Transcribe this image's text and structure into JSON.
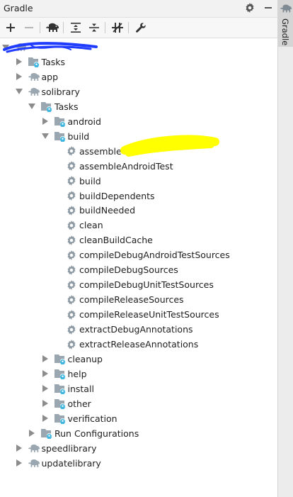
{
  "panel": {
    "title": "Gradle",
    "side_tab_label": "Gradle"
  },
  "header": {
    "settings_icon": "gear-icon",
    "minimize_icon": "minimize-icon"
  },
  "toolbar": {
    "buttons": [
      {
        "name": "add-button",
        "icon": "plus-icon",
        "enabled": true
      },
      {
        "name": "remove-button",
        "icon": "minus-icon",
        "enabled": false
      },
      {
        "name": "execute-gradle-task-button",
        "icon": "elephant-icon",
        "enabled": true
      },
      {
        "name": "expand-all-button",
        "icon": "expand-all-icon",
        "enabled": true
      },
      {
        "name": "collapse-all-button",
        "icon": "collapse-all-icon",
        "enabled": true
      },
      {
        "name": "toggle-offline-mode-button",
        "icon": "offline-icon",
        "enabled": true
      },
      {
        "name": "build-settings-button",
        "icon": "wrench-icon",
        "enabled": true
      }
    ]
  },
  "tree": [
    {
      "depth": 0,
      "expanded": true,
      "icon": "gradle-elephant",
      "label": ""
    },
    {
      "depth": 1,
      "expanded": false,
      "icon": "task-folder",
      "label": "Tasks"
    },
    {
      "depth": 1,
      "expanded": false,
      "icon": "gradle-elephant",
      "label": "app"
    },
    {
      "depth": 1,
      "expanded": true,
      "icon": "gradle-elephant",
      "label": "solibrary"
    },
    {
      "depth": 2,
      "expanded": true,
      "icon": "task-folder",
      "label": "Tasks"
    },
    {
      "depth": 3,
      "expanded": false,
      "icon": "task-folder",
      "label": "android"
    },
    {
      "depth": 3,
      "expanded": true,
      "icon": "task-folder",
      "label": "build"
    },
    {
      "depth": 4,
      "leaf": true,
      "icon": "gear",
      "label": "assemble"
    },
    {
      "depth": 4,
      "leaf": true,
      "icon": "gear",
      "label": "assembleAndroidTest"
    },
    {
      "depth": 4,
      "leaf": true,
      "icon": "gear",
      "label": "build"
    },
    {
      "depth": 4,
      "leaf": true,
      "icon": "gear",
      "label": "buildDependents"
    },
    {
      "depth": 4,
      "leaf": true,
      "icon": "gear",
      "label": "buildNeeded"
    },
    {
      "depth": 4,
      "leaf": true,
      "icon": "gear",
      "label": "clean"
    },
    {
      "depth": 4,
      "leaf": true,
      "icon": "gear",
      "label": "cleanBuildCache"
    },
    {
      "depth": 4,
      "leaf": true,
      "icon": "gear",
      "label": "compileDebugAndroidTestSources"
    },
    {
      "depth": 4,
      "leaf": true,
      "icon": "gear",
      "label": "compileDebugSources"
    },
    {
      "depth": 4,
      "leaf": true,
      "icon": "gear",
      "label": "compileDebugUnitTestSources"
    },
    {
      "depth": 4,
      "leaf": true,
      "icon": "gear",
      "label": "compileReleaseSources"
    },
    {
      "depth": 4,
      "leaf": true,
      "icon": "gear",
      "label": "compileReleaseUnitTestSources"
    },
    {
      "depth": 4,
      "leaf": true,
      "icon": "gear",
      "label": "extractDebugAnnotations"
    },
    {
      "depth": 4,
      "leaf": true,
      "icon": "gear",
      "label": "extractReleaseAnnotations"
    },
    {
      "depth": 3,
      "expanded": false,
      "icon": "task-folder",
      "label": "cleanup"
    },
    {
      "depth": 3,
      "expanded": false,
      "icon": "task-folder",
      "label": "help"
    },
    {
      "depth": 3,
      "expanded": false,
      "icon": "task-folder",
      "label": "install"
    },
    {
      "depth": 3,
      "expanded": false,
      "icon": "task-folder",
      "label": "other"
    },
    {
      "depth": 3,
      "expanded": false,
      "icon": "task-folder",
      "label": "verification"
    },
    {
      "depth": 2,
      "expanded": false,
      "icon": "task-folder",
      "label": "Run Configurations"
    },
    {
      "depth": 1,
      "expanded": false,
      "icon": "gradle-elephant",
      "label": "speedlibrary"
    },
    {
      "depth": 1,
      "expanded": false,
      "icon": "gradle-elephant",
      "label": "updatelibrary"
    }
  ],
  "colors": {
    "elephant": "#9aa7b0",
    "folder": "#9aa7b0",
    "task_badge": "#40b6e0",
    "gear": "#8e9aa3",
    "redaction_blue": "#1f3cff",
    "highlight_yellow": "#ffff00"
  }
}
